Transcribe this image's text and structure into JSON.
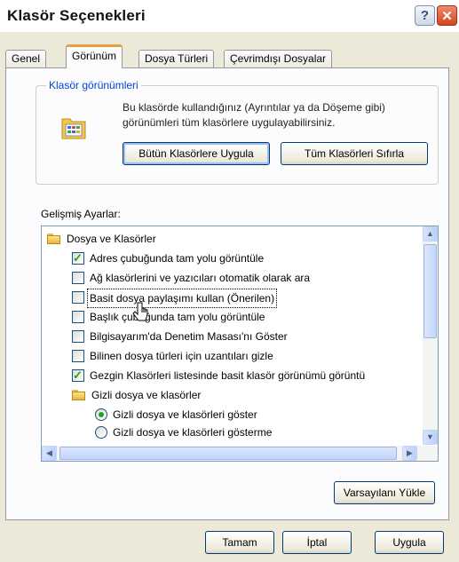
{
  "window": {
    "title": "Klasör Seçenekleri",
    "help_label": "?",
    "close_label": "✕"
  },
  "tabs": [
    "Genel",
    "Görünüm",
    "Dosya Türleri",
    "Çevrimdışı Dosyalar"
  ],
  "group": {
    "legend": "Klasör görünümleri",
    "description": "Bu klasörde kullandığınız (Ayrıntılar ya da Döşeme gibi) görünümleri tüm klasörlere uygulayabilirsiniz.",
    "apply_all_label": "Bütün Klasörlere Uygula",
    "reset_all_label": "Tüm Klasörleri Sıfırla"
  },
  "advanced": {
    "label": "Gelişmiş Ayarlar:",
    "items": [
      {
        "type": "folder",
        "label": "Dosya ve Klasörler"
      },
      {
        "type": "checkbox",
        "checked": true,
        "label": "Adres çubuğunda tam yolu görüntüle"
      },
      {
        "type": "checkbox",
        "checked": false,
        "label": "Ağ klasörlerini ve yazıcıları otomatik olarak ara"
      },
      {
        "type": "checkbox",
        "checked": false,
        "label": "Basit dosya paylaşımı kullan (Önerilen)",
        "focused": true
      },
      {
        "type": "checkbox",
        "checked": false,
        "label": "Başlık çubuğunda tam yolu görüntüle"
      },
      {
        "type": "checkbox",
        "checked": false,
        "label": "Bilgisayarım'da Denetim Masası'nı Göster"
      },
      {
        "type": "checkbox",
        "checked": false,
        "label": "Bilinen dosya türleri için uzantıları gizle"
      },
      {
        "type": "checkbox",
        "checked": true,
        "label": "Gezgin Klasörleri listesinde basit klasör görünümü görüntü"
      },
      {
        "type": "folder",
        "label": "Gizli dosya ve klasörler"
      },
      {
        "type": "radio",
        "checked": true,
        "label": "Gizli dosya ve klasörleri göster"
      },
      {
        "type": "radio",
        "checked": false,
        "label": "Gizli dosya ve klasörleri gösterme"
      }
    ],
    "restore_label": "Varsayılanı Yükle"
  },
  "footer": {
    "ok_label": "Tamam",
    "cancel_label": "İptal",
    "apply_label": "Uygula"
  },
  "colors": {
    "tab_accent": "#e6a23c",
    "legend": "#0046d5",
    "check": "#21a121",
    "close": "#d3451f"
  }
}
